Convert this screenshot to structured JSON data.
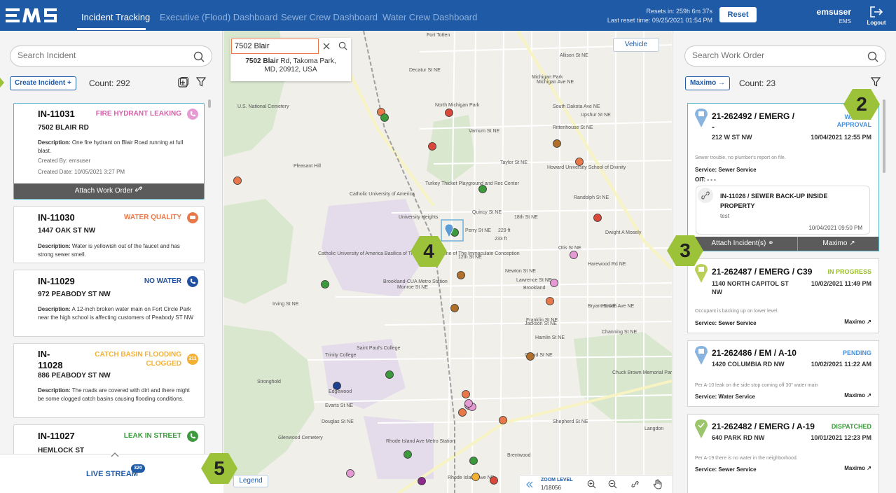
{
  "nav": {
    "tabs": [
      {
        "label": "Incident Tracking",
        "active": true
      },
      {
        "label": "Executive (Flood) Dashboard",
        "active": false
      },
      {
        "label": "Sewer Crew Dashboard",
        "active": false
      },
      {
        "label": "Water Crew Dashboard",
        "active": false
      }
    ],
    "resets_in": "Resets in: 259h 6m 37s",
    "last_reset": "Last reset time: 09/25/2021 01:54 PM",
    "reset_label": "Reset",
    "username": "emsuser",
    "org": "EMS",
    "logout_label": "Logout"
  },
  "left": {
    "search_placeholder": "Search Incident",
    "create_label": "Create Incident",
    "count_text": "Count: 292",
    "incidents": [
      {
        "id": "IN-11031",
        "type": "FIRE HYDRANT LEAKING",
        "type_color": "#d85fa8",
        "address": "7502 BLAIR RD",
        "desc_label": "Description:",
        "desc": "One fire hydrant on Blair Road running at full blast.",
        "created_by": "Created By: emsuser",
        "created_date": "Created Date: 10/05/2021 3:27 PM",
        "attach_label": "Attach Work Order"
      },
      {
        "id": "IN-11030",
        "type": "WATER QUALITY",
        "type_color": "#e8784a",
        "address": "1447 OAK ST NW",
        "desc_label": "Description:",
        "desc": "Water is yellowish out of the faucet and has strong sewer smell."
      },
      {
        "id": "IN-11029",
        "type": "NO WATER",
        "type_color": "#1f4fa0",
        "address": "972 PEABODY ST NW",
        "desc_label": "Description:",
        "desc": "A 12-inch broken water main on Fort Circle Park near the high school is affecting customers of Peabody ST NW"
      },
      {
        "id": "IN-",
        "id2": "11028",
        "type": "CATCH BASIN FLOODING",
        "type2": "CLOGGED",
        "type_color": "#f2b134",
        "badge": "311",
        "address": "886 PEABODY ST NW",
        "desc_label": "Description:",
        "desc": "The roads are covered with dirt and there might be some clogged catch basins causing flooding conditions."
      },
      {
        "id": "IN-11027",
        "type": "LEAK IN STREET",
        "type_color": "#3c9a3c",
        "address": "HEMLOCK ST"
      }
    ],
    "live_stream": "LIVE STREAM",
    "live_count": "320"
  },
  "map": {
    "search_value": "7502 Blair",
    "suggestion_bold": "7502 Blair",
    "suggestion_rest": " Rd, Takoma Park,",
    "suggestion_line2": "MD, 20912, USA",
    "vehicle_label": "Vehicle",
    "legend_label": "Legend",
    "zoom_label": "ZOOM LEVEL",
    "zoom_value": "1/18056",
    "labels": [
      "U.S. National Cemetery",
      "North Michigan Park",
      "Michigan Park",
      "Pleasant Hill",
      "Catholic University of America",
      "Turkey Thicket Playground and Rec Center",
      "Howard University School of Divinity",
      "University Heights",
      "Dwight A Mosely",
      "Catholic University of America Basilica of The National Shrine of The Immaculate Conception",
      "Brookland-CUA Metro Station",
      "Brookland",
      "Trinity College",
      "Saint Paul's College",
      "Chuck Brown Memorial Park",
      "Stronghold",
      "Edgewood",
      "Glenwood Cemetery",
      "Rhode Island Ave Metro Station",
      "Brentwood",
      "Langdon",
      "Fort Totten",
      "Decatur St NE",
      "Varnum St NE",
      "Taylor St NE",
      "Quincy St NE",
      "Perry St NE",
      "Monroe St NE",
      "Irving St NE",
      "Evarts St NE",
      "Douglas St NE",
      "Rhode Island Ave NE",
      "Michigan Ave NE",
      "South Dakota Ave NE",
      "Franklin St NE",
      "12th St NE",
      "18th St NE",
      "Allison St NE",
      "Upshur St NE",
      "Rittenhouse St NE",
      "233 ft",
      "229 ft",
      "Harewood Rd NE",
      "Hawaii Ave NE",
      "Otis St NE",
      "Newton St NE",
      "Lawrence St NE",
      "Jackson St NE",
      "Hamlin St NE",
      "Girard St NE",
      "Randolph St NE",
      "Bryant St NE",
      "Channing St NE",
      "Shepherd St NE"
    ],
    "dot_colors": [
      "#d9483b",
      "#e8784a",
      "#3c9a3c",
      "#b06f2b",
      "#e59ad4",
      "#1f3f8f",
      "#8b2b8b",
      "#f2b134"
    ]
  },
  "right": {
    "search_placeholder": "Search Work Order",
    "maximo_label": "Maximo",
    "count_text": "Count: 23",
    "work_orders": [
      {
        "title": "21-262492 / EMERG /",
        "title2": "-",
        "status": "WAITING",
        "status2": "APPROVAL",
        "status_color": "#4a90d9",
        "address": "212 W ST NW",
        "date": "10/04/2021 12:55 PM",
        "note": "Sewer trouble, no plumber's report on file.",
        "service": "Service: Sewer Service",
        "oit": "OIT: - - -",
        "linked_title": "IN-11026 / SEWER BACK-UP INSIDE PROPERTY",
        "linked_desc": "test",
        "linked_date": "10/04/2021 09:50 PM",
        "attach_label": "Attach Incident(s)",
        "maximo": "Maximo"
      },
      {
        "title": "21-262487 / EMERG / C39",
        "status": "IN PROGRESS",
        "status_color": "#9bbf2a",
        "address": "1140 NORTH CAPITOL ST NW",
        "date": "10/02/2021 11:49 PM",
        "note": "Occupant is backing up on lower level.",
        "service": "Service: Sewer Service",
        "maximo": "Maximo"
      },
      {
        "title": "21-262486 / EM / A-10",
        "status": "PENDING",
        "status_color": "#4a90d9",
        "address": "1420 COLUMBIA RD NW",
        "date": "10/02/2021 11:22 AM",
        "note": "Per A-10 leak on the side stop coming off 30\" water main",
        "service": "Service: Water Service",
        "maximo": "Maximo"
      },
      {
        "title": "21-262482 / EMERG / A-19",
        "status": "DISPATCHED",
        "status_color": "#3c9a3c",
        "address": "640 PARK RD NW",
        "date": "10/01/2021 12:23 PM",
        "note": "Per A-19 there is no water in the neighborhood.",
        "service": "Service: Sewer Service",
        "maximo": "Maximo"
      }
    ]
  },
  "badges": [
    "2",
    "3",
    "4",
    "5"
  ],
  "colors": {
    "brand": "#1f5aa6",
    "badge": "#9cc23a"
  }
}
